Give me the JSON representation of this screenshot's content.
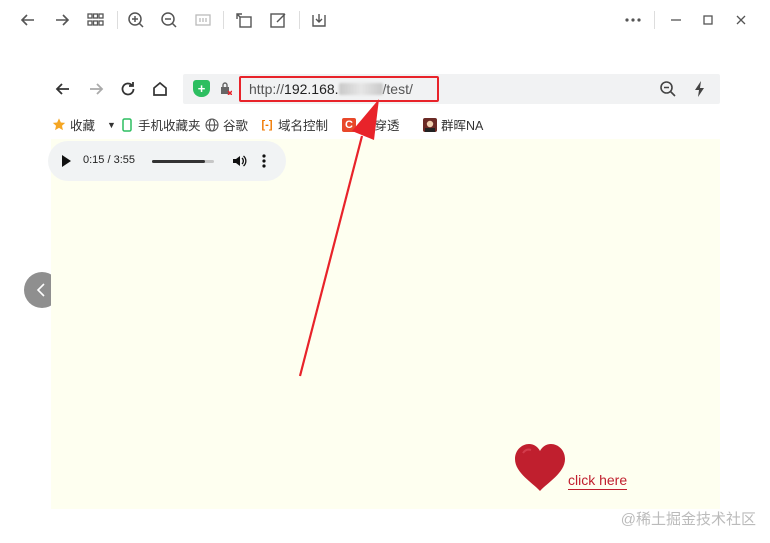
{
  "viewer": {
    "icons": [
      "back-icon",
      "forward-icon",
      "grid-icon",
      "zoom-in-icon",
      "zoom-out-icon",
      "fit-icon",
      "rotate-icon",
      "edit-icon",
      "download-icon",
      "more-icon",
      "minimize-icon",
      "maximize-icon",
      "close-icon"
    ]
  },
  "browser": {
    "url_prefix": "http://",
    "url_host": "192.168.",
    "url_suffix": "/test/",
    "bookmarks": [
      {
        "label": "收藏",
        "icon": "star-icon"
      },
      {
        "label": "手机收藏夹",
        "icon": "phone-icon"
      },
      {
        "label": "谷歌",
        "icon": "globe-icon"
      },
      {
        "label": "域名控制",
        "icon": "domain-icon"
      },
      {
        "label": "网穿透",
        "icon": "c-logo-icon"
      },
      {
        "label": "群晖NA",
        "icon": "avatar-icon"
      }
    ]
  },
  "audio": {
    "time": "0:15 / 3:55",
    "progress": 0.85
  },
  "page": {
    "link_text": "click here"
  },
  "watermark": "@稀土掘金技术社区",
  "colors": {
    "highlight": "#e8232a",
    "page_bg": "#fefff0",
    "heart": "#c01f2e"
  }
}
